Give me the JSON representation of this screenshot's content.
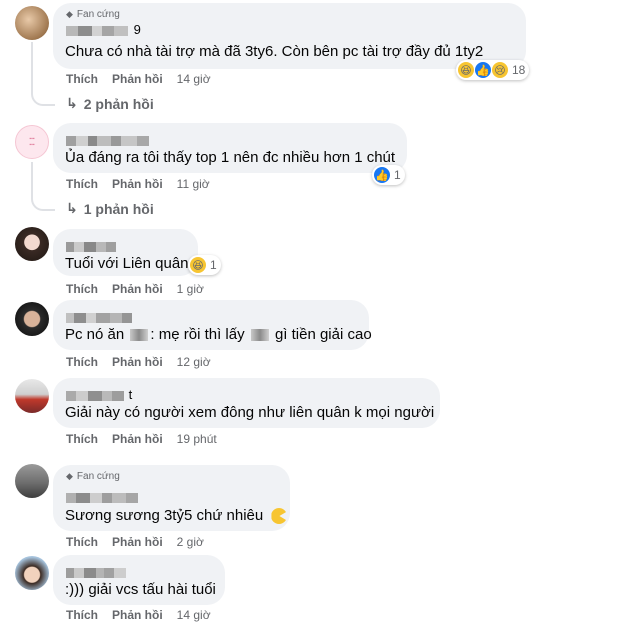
{
  "comments": [
    {
      "badge": "Fan cứng",
      "name_suffix": "9",
      "text": "Chưa có nhà tài trợ mà đã 3ty6. Còn bên pc tài trợ đầy đủ 1ty2",
      "like_label": "Thích",
      "reply_label": "Phản hồi",
      "time": "14 giờ",
      "reaction_count": "18",
      "reaction_icons": [
        "haha-icon",
        "like-icon",
        "sad-icon"
      ],
      "replies_label": "2 phản hồi"
    },
    {
      "text": "Ủa đáng ra tôi thấy top 1 nên đc nhiều hơn 1 chút",
      "like_label": "Thích",
      "reply_label": "Phản hồi",
      "time": "11 giờ",
      "reaction_count": "1",
      "reaction_icons": [
        "like-icon"
      ],
      "replies_label": "1 phản hồi"
    },
    {
      "text": "Tuổi với Liên quân",
      "like_label": "Thích",
      "reply_label": "Phản hồi",
      "time": "1 giờ",
      "reaction_count": "1",
      "reaction_icons": [
        "haha-icon"
      ]
    },
    {
      "text_before": "Pc nó ăn",
      "text_mid": ": mẹ rồi thì lấy",
      "text_after": "gì tiền giải cao",
      "like_label": "Thích",
      "reply_label": "Phản hồi",
      "time": "12 giờ"
    },
    {
      "name_suffix": "t",
      "text": "Giải này có người xem đông như liên quân k mọi người",
      "like_label": "Thích",
      "reply_label": "Phản hồi",
      "time": "19 phút"
    },
    {
      "badge": "Fan cứng",
      "text": "Sương sương 3tỷ5 chứ nhiêu",
      "like_label": "Thích",
      "reply_label": "Phản hồi",
      "time": "2 giờ"
    },
    {
      "text": ":))) giải vcs tấu hài tuổi",
      "like_label": "Thích",
      "reply_label": "Phản hồi",
      "time": "14 giờ"
    }
  ],
  "colors": {
    "bubble": "#f0f2f5",
    "secondary_text": "#65676b",
    "like_blue": "#1877f2",
    "haha_yellow": "#f7c531"
  }
}
